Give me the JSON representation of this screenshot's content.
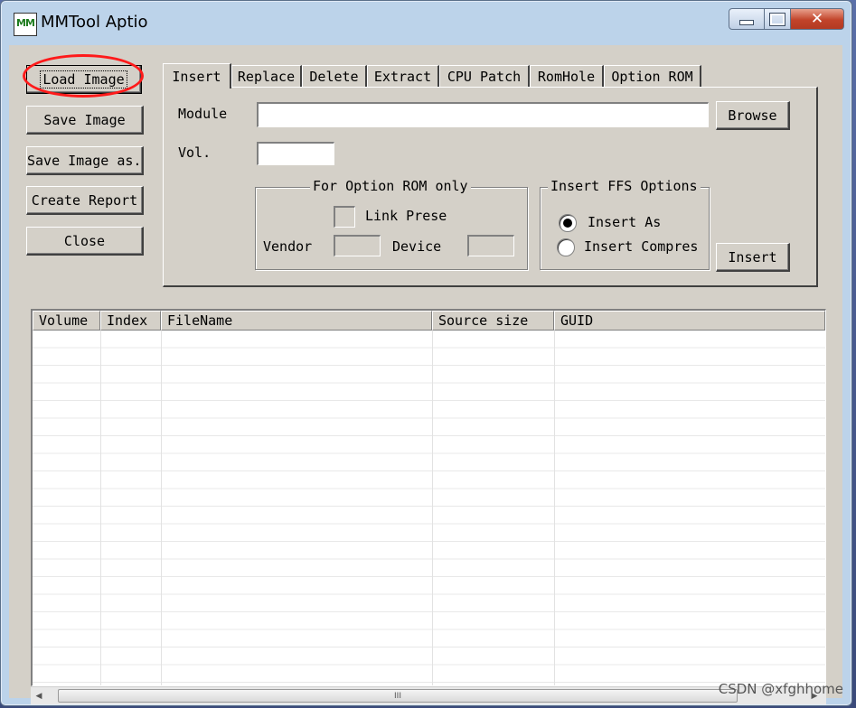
{
  "window": {
    "title": "MMTool Aptio",
    "icon_label": "MM",
    "close_glyph": "✕"
  },
  "left_buttons": {
    "load_image": "Load Image",
    "save_image": "Save Image",
    "save_image_as": "Save Image as...",
    "create_report": "Create Report",
    "close": "Close"
  },
  "tabs": [
    "Insert",
    "Replace",
    "Delete",
    "Extract",
    "CPU Patch",
    "RomHole",
    "Option ROM"
  ],
  "insert_panel": {
    "module_label": "Module",
    "module_value": "",
    "browse_label": "Browse",
    "vol_label": "Vol.",
    "vol_value": "",
    "option_rom_group": {
      "title": "For Option ROM only",
      "link_present_label": "Link Prese",
      "vendor_label": "Vendor",
      "device_label": "Device"
    },
    "ffs_group": {
      "title": "Insert FFS Options",
      "insert_as_label": "Insert As",
      "insert_compressed_label": "Insert Compres"
    },
    "insert_button": "Insert"
  },
  "table": {
    "columns": [
      "Volume",
      "Index",
      "FileName",
      "Source size",
      "GUID"
    ],
    "rows": []
  },
  "scrollbar": {
    "left_arrow": "◀",
    "right_arrow": "▶",
    "grip": "III"
  },
  "watermark": "CSDN @xfghhome",
  "colors": {
    "highlight_ring": "#ff1a1a",
    "window_frame": "#bcd3ea",
    "dialog_face": "#d4d0c8"
  }
}
